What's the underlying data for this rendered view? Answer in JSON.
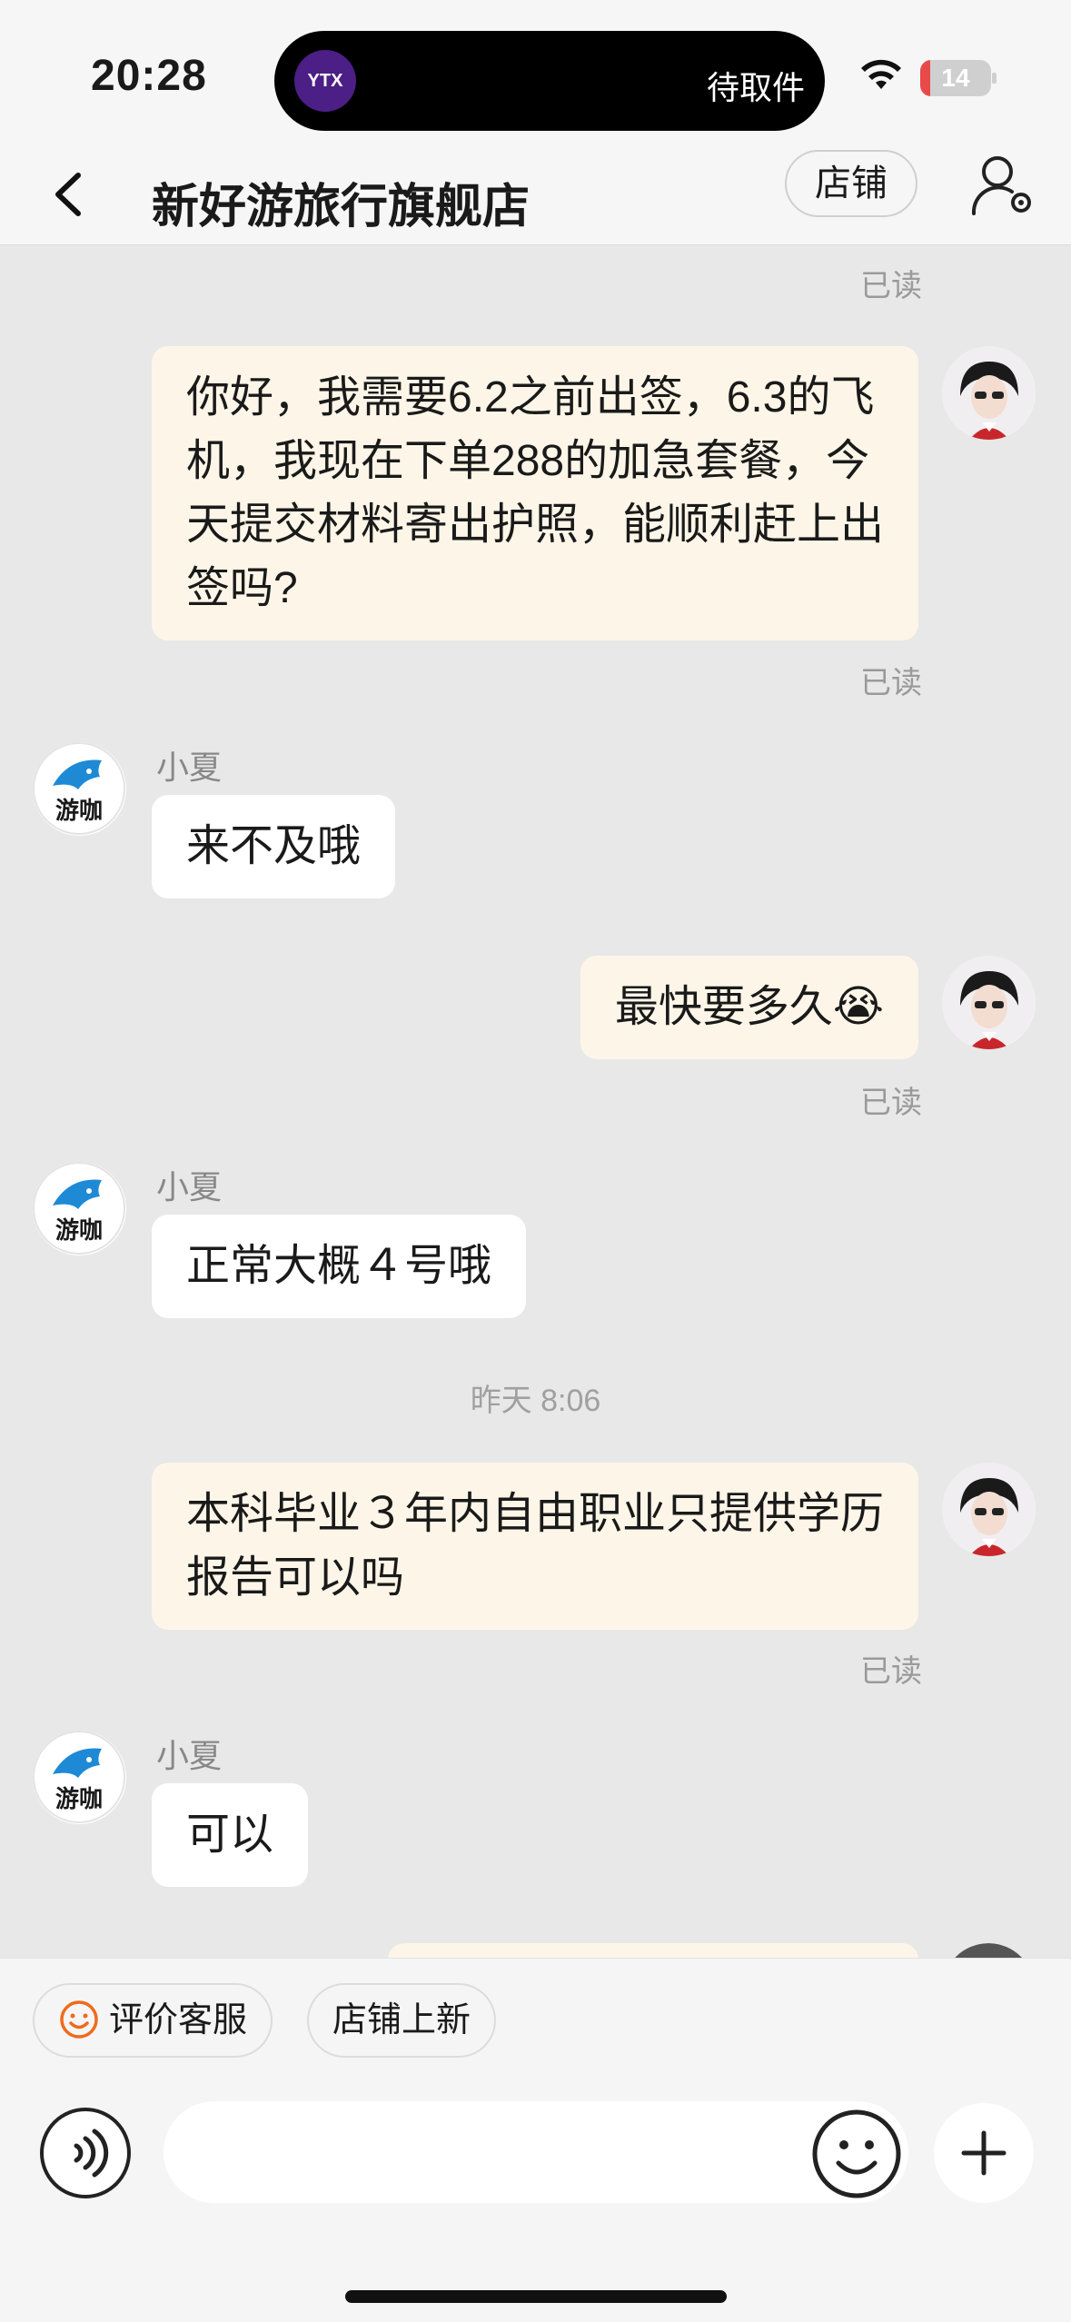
{
  "status_bar": {
    "time": "20:28",
    "island_app": "YTX",
    "island_text": "待取件",
    "battery": "14",
    "battery_level": 0.14
  },
  "header": {
    "back_icon": "chevron-left-icon",
    "title": "新好游旅行旗舰店",
    "shop_button": "店铺",
    "settings_icon": "user-settings-icon"
  },
  "chat": {
    "top_read": "已读",
    "messages": [
      {
        "from": "user",
        "text": "你好，我需要6.2之前出签，6.3的飞机，我现在下单288的加急套餐，今天提交材料寄出护照，能顺利赶上出签吗?",
        "status": "已读"
      },
      {
        "from": "agent",
        "sender": "小夏",
        "text": "来不及哦"
      },
      {
        "from": "user",
        "text": "最快要多久😭",
        "status": "已读"
      },
      {
        "from": "agent",
        "sender": "小夏",
        "text": "正常大概４号哦"
      },
      {
        "from": "timestamp",
        "text": "昨天 8:06"
      },
      {
        "from": "user",
        "text": "本科毕业３年内自由职业只提供学历报告可以吗",
        "status": "已读"
      },
      {
        "from": "agent",
        "sender": "小夏",
        "text": "可以"
      }
    ],
    "agent_avatar_label": "游咖"
  },
  "quick_actions": [
    {
      "label": "评价客服",
      "icon": "smiley-icon"
    },
    {
      "label": "店铺上新"
    }
  ],
  "composer": {
    "voice_icon": "voice-icon",
    "input_placeholder": "",
    "emoji_icon": "emoji-icon",
    "plus_icon": "plus-icon"
  },
  "colors": {
    "user_bubble": "#fdf6e8",
    "agent_bubble": "#ffffff",
    "background": "#e8e8e8",
    "accent": "#f06a1c"
  }
}
